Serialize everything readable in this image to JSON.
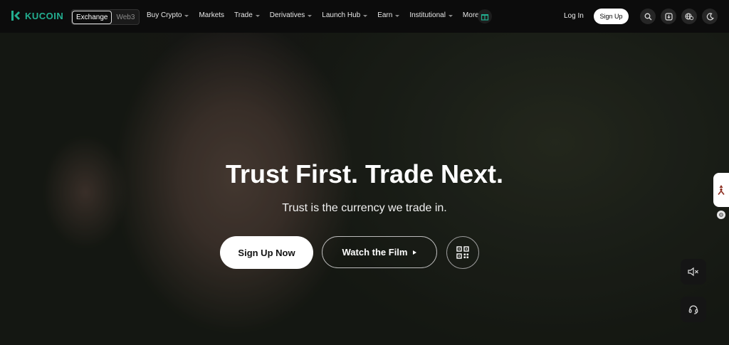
{
  "brand": {
    "name": "KUCOIN",
    "accent": "#23af91"
  },
  "nav": {
    "mode_toggle": {
      "exchange": "Exchange",
      "web3": "Web3"
    },
    "menu": [
      {
        "label": "Buy Crypto",
        "dropdown": true
      },
      {
        "label": "Markets",
        "dropdown": false
      },
      {
        "label": "Trade",
        "dropdown": true
      },
      {
        "label": "Derivatives",
        "dropdown": true
      },
      {
        "label": "Launch Hub",
        "dropdown": true
      },
      {
        "label": "Earn",
        "dropdown": true
      },
      {
        "label": "Institutional",
        "dropdown": true
      },
      {
        "label": "More",
        "dropdown": true
      }
    ],
    "login": "Log In",
    "signup": "Sign Up",
    "icons": [
      "gift-icon",
      "search-icon",
      "download-icon",
      "globe-currency-icon",
      "moon-icon"
    ]
  },
  "hero": {
    "title": "Trust First. Trade Next.",
    "subtitle": "Trust is the currency we trade in.",
    "primary_cta": "Sign Up Now",
    "secondary_cta": "Watch the Film",
    "qr_icon": "qr-code-icon"
  },
  "floating": {
    "side_tab_icon": "person-arrow-icon",
    "settings_icon": "gear-icon",
    "mute_icon": "mute-icon",
    "support_icon": "headset-icon"
  }
}
